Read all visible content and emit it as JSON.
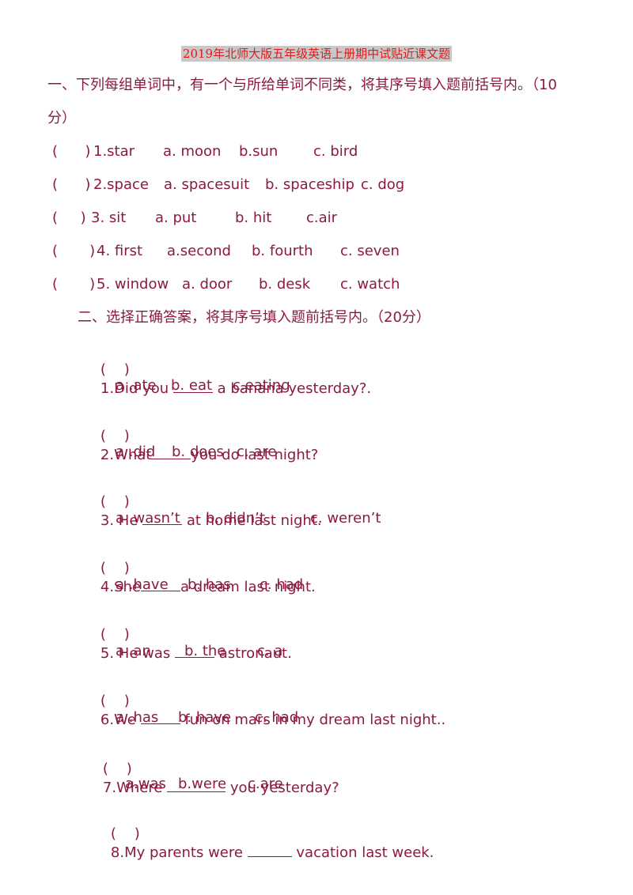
{
  "doc_title": "2019年北师大版五年级英语上册期中试贴近课文题",
  "section1": {
    "heading_line1": "一、下列每组单词中，有一个与所给单词不同类，将其序号填入题前括号内。（10",
    "heading_line2": "分）",
    "items": [
      {
        "paren": "(      )",
        "word": "1.star",
        "a": "a. moon",
        "b": "b.sun",
        "c": "c. bird"
      },
      {
        "paren": "(      )",
        "word": "2.space",
        "a": "a. spacesuit",
        "b": "b. spaceship",
        "c": "c. dog"
      },
      {
        "paren": "(     )",
        "word": "3. sit",
        "a": "a. put",
        "b": "b. hit",
        "c": "c.air"
      },
      {
        "paren": "(       )",
        "word": "4. first",
        "a": "a.second",
        "b": "b. fourth",
        "c": "c. seven"
      },
      {
        "paren": "(       )",
        "word": "5. window",
        "a": "a. door",
        "b": "b. desk",
        "c": "c. watch"
      }
    ]
  },
  "section2": {
    "heading": "二、选择正确答案，将其序号填入题前括号内。（20分）",
    "questions": [
      {
        "paren": "(    )",
        "pre": "1.Did you ",
        "post": " a banana yesterday?.",
        "a": "a .ate",
        "b": "b. eat",
        "c": "c.eating"
      },
      {
        "paren": "(    )",
        "pre": "2.What",
        "post": "you do last night?",
        "a": "a .did",
        "b": "b. does",
        "c": "c. are"
      },
      {
        "paren": "(    )",
        "pre": "3. He ",
        "post": " at home last night.",
        "a": "a .wasn’t",
        "b": "b. didn’t",
        "c": "c. weren’t"
      },
      {
        "paren": "(    )",
        "pre": "4.She",
        "post": "a dream last night.",
        "a": "a .have",
        "b": "b. has",
        "c": "c. had"
      },
      {
        "paren": "(    )",
        "pre": "5. He was ",
        "post": " astronaut.",
        "a": "a .an",
        "b": "b. the",
        "c": "c. a"
      },
      {
        "paren": "(    )",
        "pre": "6.We ",
        "post": " fun on mars in my dream last night..",
        "a": "a .has",
        "b": "b. have",
        "c": "c. had"
      },
      {
        "paren": "(    )",
        "pre": "7.Where ",
        "post": " you yesterday?",
        "a": "a.was",
        "b": "b.were",
        "c": "c.are"
      },
      {
        "paren": "(    )",
        "pre": "8.My parents were ",
        "post": " vacation last week."
      }
    ]
  }
}
